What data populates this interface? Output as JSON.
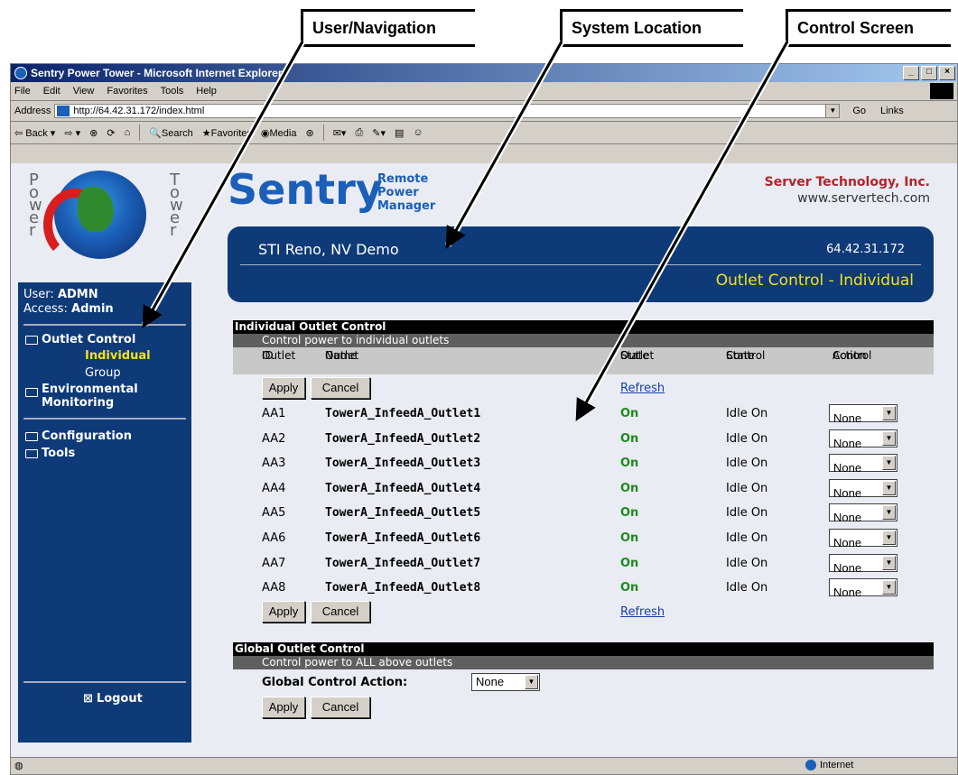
{
  "callouts": {
    "user_nav": "User/Navigation",
    "system_location": "System Location",
    "control_screen": "Control Screen"
  },
  "browser": {
    "title": "Sentry Power Tower - Microsoft Internet Explorer",
    "menu": [
      "File",
      "Edit",
      "View",
      "Favorites",
      "Tools",
      "Help"
    ],
    "address_label": "Address",
    "url": "http://64.42.31.172/index.html",
    "go": "Go",
    "links": "Links",
    "toolbar": [
      "Back",
      "Search",
      "Favorites",
      "Media"
    ],
    "status_zone": "Internet"
  },
  "header": {
    "brand": "Sentry",
    "product": [
      "Remote",
      "Power",
      "Manager"
    ],
    "company": "Server Technology, Inc.",
    "website": "www.servertech.com",
    "location": "STI Reno, NV Demo",
    "ip": "64.42.31.172",
    "screen_title": "Outlet Control - Individual"
  },
  "sidebar": {
    "user_label": "User:",
    "user": "ADMN",
    "access_label": "Access:",
    "access": "Admin",
    "items": [
      {
        "label": "Outlet Control"
      },
      {
        "label": "Individual"
      },
      {
        "label": "Group"
      },
      {
        "label": "Environmental"
      },
      {
        "label": "Monitoring"
      },
      {
        "label": "Configuration"
      },
      {
        "label": "Tools"
      }
    ],
    "logout": "Logout"
  },
  "individual": {
    "heading": "Individual Outlet Control",
    "subheading": "Control power to individual outlets",
    "columns": {
      "id": [
        "Outlet",
        "ID"
      ],
      "name": [
        "Outlet",
        "Name"
      ],
      "state": [
        "Outlet",
        "State"
      ],
      "cstate": [
        "Control",
        "State"
      ],
      "action": [
        "Control",
        "Action"
      ]
    },
    "apply": "Apply",
    "cancel": "Cancel",
    "refresh": "Refresh",
    "rows": [
      {
        "id": "AA1",
        "name": "TowerA_InfeedA_Outlet1",
        "state": "On",
        "cstate": "Idle On",
        "action": "None"
      },
      {
        "id": "AA2",
        "name": "TowerA_InfeedA_Outlet2",
        "state": "On",
        "cstate": "Idle On",
        "action": "None"
      },
      {
        "id": "AA3",
        "name": "TowerA_InfeedA_Outlet3",
        "state": "On",
        "cstate": "Idle On",
        "action": "None"
      },
      {
        "id": "AA4",
        "name": "TowerA_InfeedA_Outlet4",
        "state": "On",
        "cstate": "Idle On",
        "action": "None"
      },
      {
        "id": "AA5",
        "name": "TowerA_InfeedA_Outlet5",
        "state": "On",
        "cstate": "Idle On",
        "action": "None"
      },
      {
        "id": "AA6",
        "name": "TowerA_InfeedA_Outlet6",
        "state": "On",
        "cstate": "Idle On",
        "action": "None"
      },
      {
        "id": "AA7",
        "name": "TowerA_InfeedA_Outlet7",
        "state": "On",
        "cstate": "Idle On",
        "action": "None"
      },
      {
        "id": "AA8",
        "name": "TowerA_InfeedA_Outlet8",
        "state": "On",
        "cstate": "Idle On",
        "action": "None"
      }
    ]
  },
  "global": {
    "heading": "Global Outlet Control",
    "subheading": "Control power to ALL above outlets",
    "action_label": "Global Control Action:",
    "action_value": "None",
    "apply": "Apply",
    "cancel": "Cancel"
  }
}
